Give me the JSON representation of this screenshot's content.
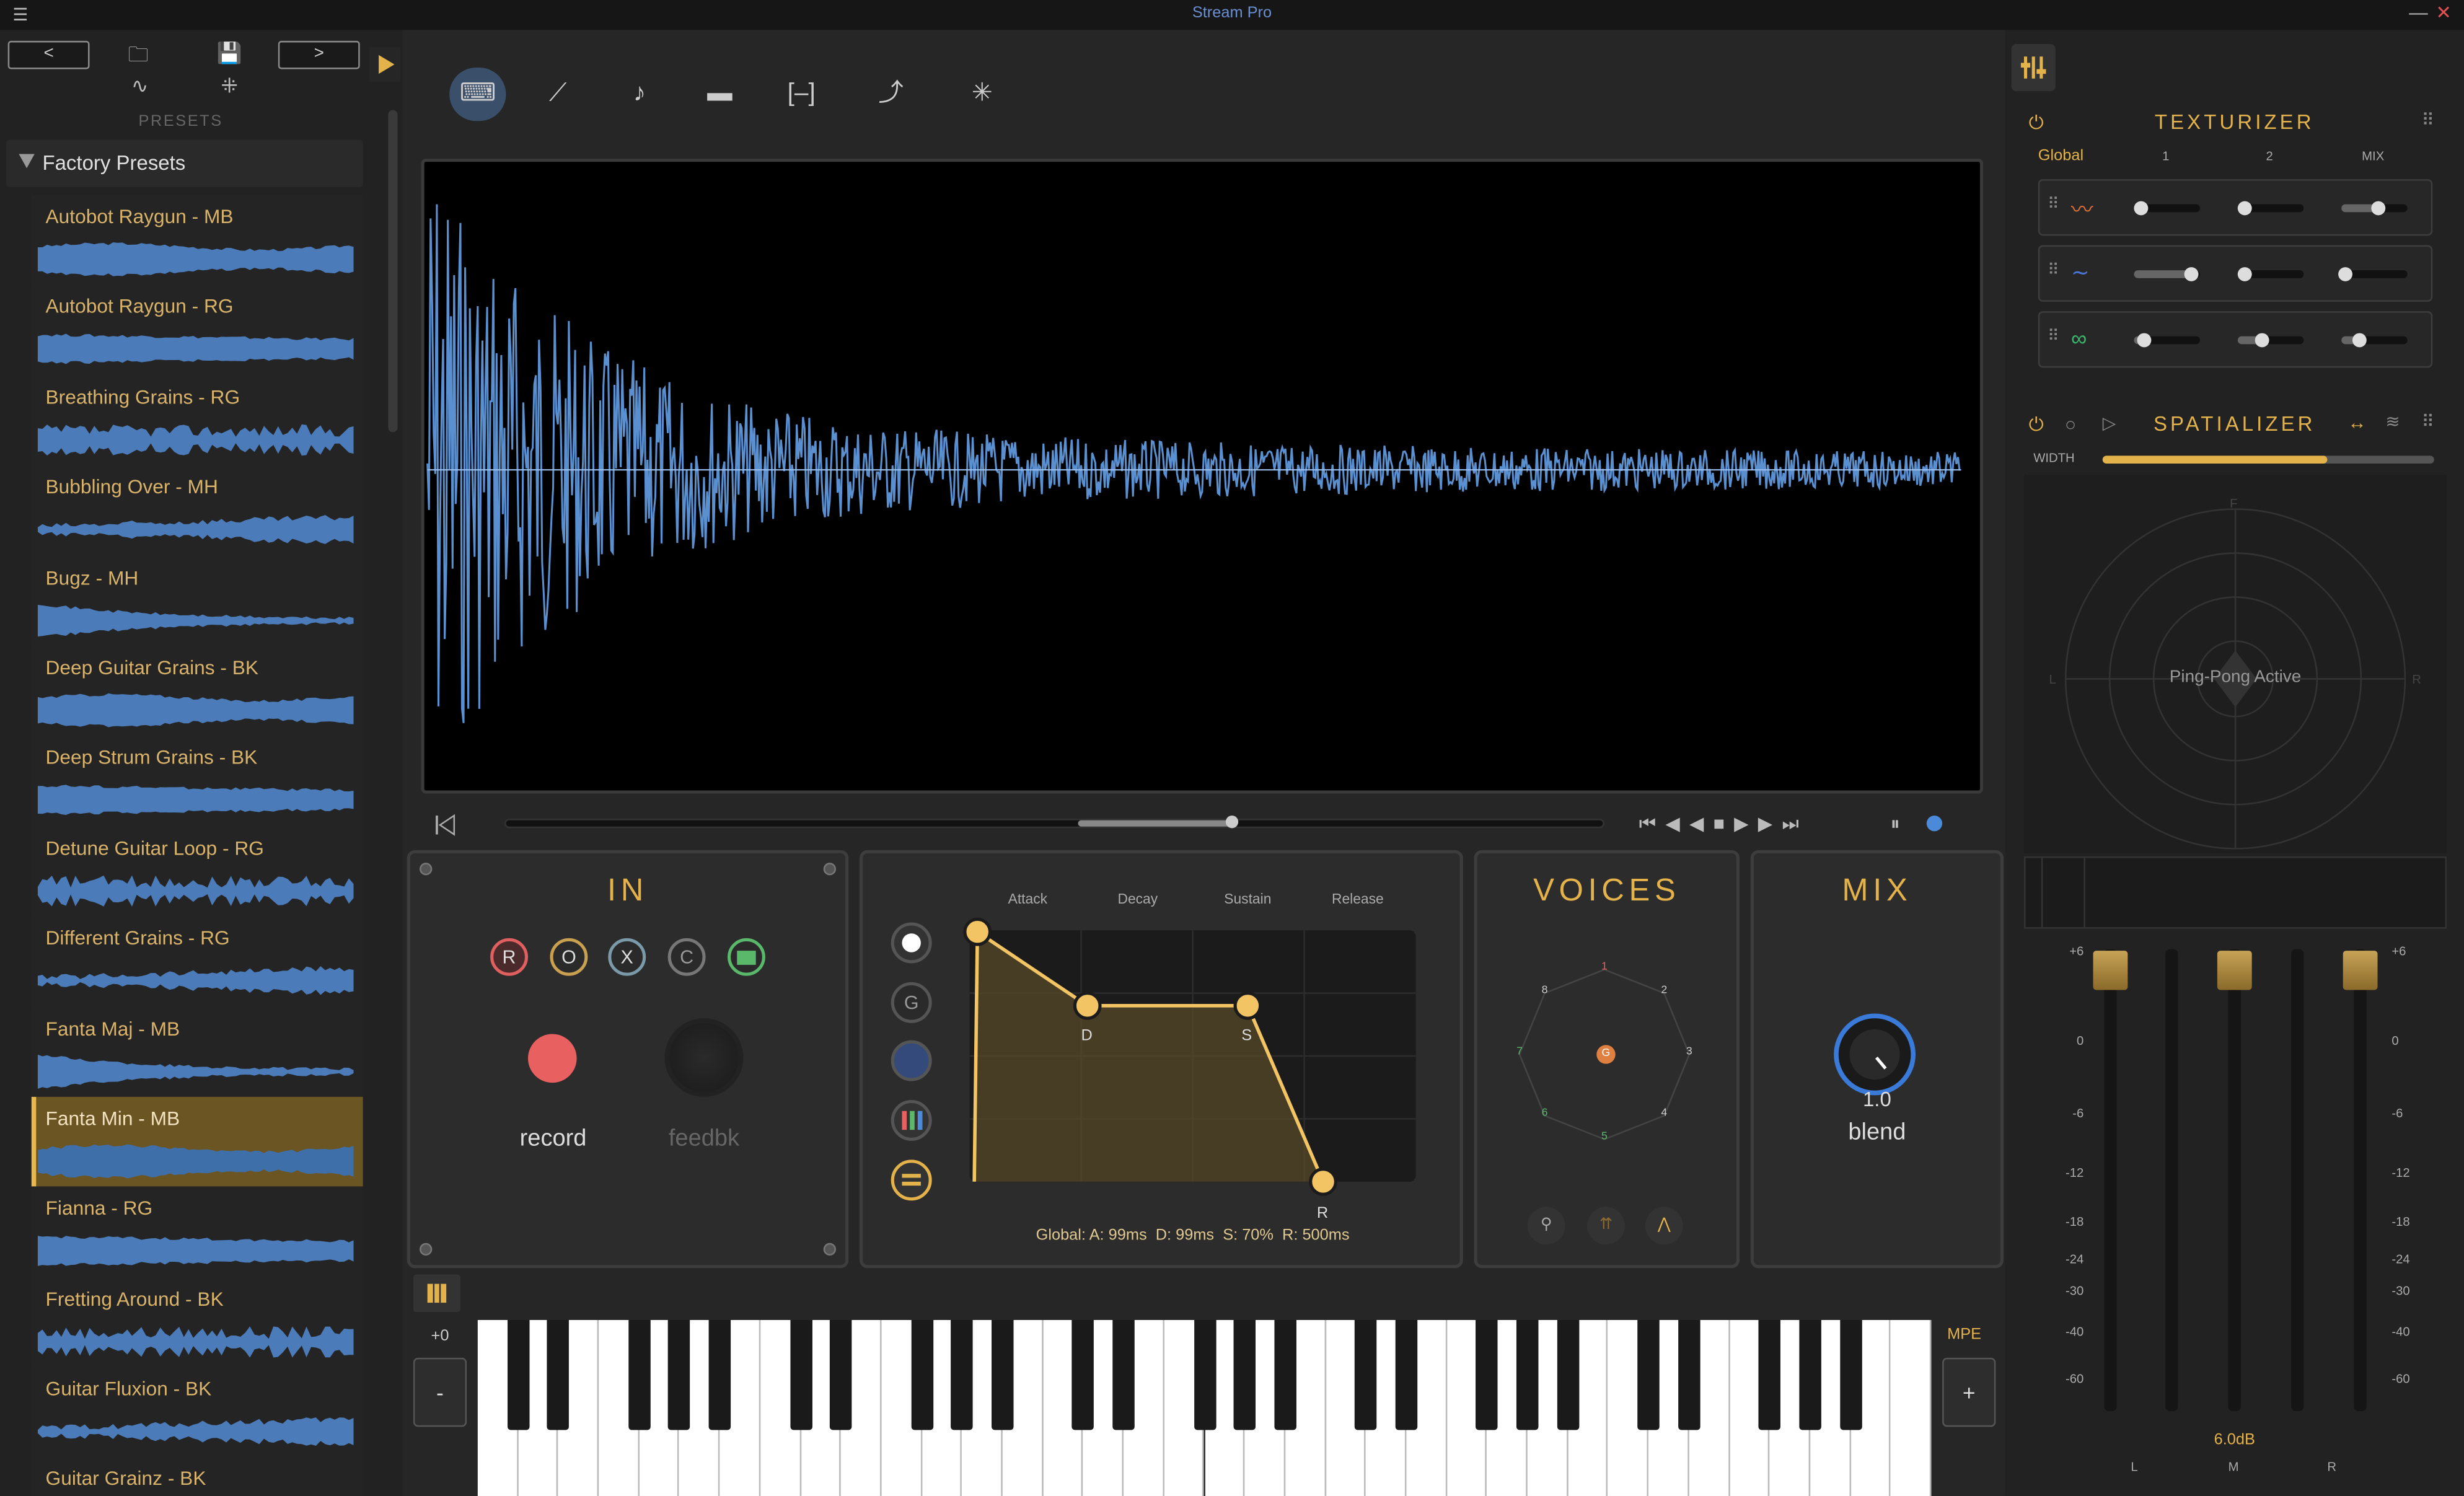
{
  "app": {
    "title": "Stream Pro"
  },
  "nav": {
    "back": "<",
    "forward": ">",
    "presets_label": "PRESETS",
    "factory_label": "Factory Presets"
  },
  "presets": [
    {
      "name": "Autobot Raygun - MB",
      "selected": false
    },
    {
      "name": "Autobot Raygun - RG",
      "selected": false
    },
    {
      "name": "Breathing Grains - RG",
      "selected": false
    },
    {
      "name": "Bubbling Over - MH",
      "selected": false
    },
    {
      "name": "Bugz - MH",
      "selected": false
    },
    {
      "name": "Deep Guitar Grains - BK",
      "selected": false
    },
    {
      "name": "Deep Strum Grains - BK",
      "selected": false
    },
    {
      "name": "Detune Guitar Loop - RG",
      "selected": false
    },
    {
      "name": "Different Grains - RG",
      "selected": false
    },
    {
      "name": "Fanta Maj - MB",
      "selected": false
    },
    {
      "name": "Fanta Min - MB",
      "selected": true
    },
    {
      "name": "Fianna - RG",
      "selected": false
    },
    {
      "name": "Fretting Around - BK",
      "selected": false
    },
    {
      "name": "Guitar Fluxion - BK",
      "selected": false
    },
    {
      "name": "Guitar Grainz - BK",
      "selected": false
    }
  ],
  "toolbar": [
    "keyboard-icon",
    "steps-icon",
    "note-icon",
    "stamp-icon",
    "bracket-icon",
    "curve-icon",
    "scatter-icon"
  ],
  "transport": {
    "position": 0.66,
    "loop_start": 0.52
  },
  "in_panel": {
    "title": "IN",
    "buttons": [
      "R",
      "O",
      "X",
      "C"
    ],
    "record_label": "record",
    "feedback_label": "feedbk"
  },
  "env_panel": {
    "headers": [
      "Attack",
      "Decay",
      "Sustain",
      "Release"
    ],
    "point_labels": [
      "D",
      "S",
      "R"
    ],
    "footer": "Global: A: 99ms  D: 99ms  S: 70%  R: 500ms",
    "side_buttons": [
      "G"
    ]
  },
  "voices_panel": {
    "title": "VOICES",
    "numbers": [
      "1",
      "2",
      "3",
      "4",
      "5",
      "6",
      "7",
      "8"
    ],
    "center": "G"
  },
  "mix_panel": {
    "title": "MIX",
    "value": "1.0",
    "label": "blend"
  },
  "texturizer": {
    "title": "TEXTURIZER",
    "columns": [
      "Global",
      "1",
      "2",
      "MIX"
    ],
    "rows": [
      {
        "icon": "noise-icon",
        "color": "#e0703a",
        "values": [
          0.1,
          0.1,
          0.55
        ]
      },
      {
        "icon": "wave-icon",
        "color": "#4a78d8",
        "values": [
          0.85,
          0.1,
          0.05
        ]
      },
      {
        "icon": "loop-icon",
        "color": "#3ab86a",
        "values": [
          0.15,
          0.35,
          0.25
        ]
      }
    ]
  },
  "spatializer": {
    "title": "SPATIALIZER",
    "width_label": "WIDTH",
    "width_value": 0.68,
    "center_text": "Ping-Pong Active",
    "front": "F",
    "left": "L",
    "right": "R"
  },
  "meters": {
    "scale_left": [
      "+6",
      "0",
      "-6",
      "-12",
      "-18",
      "-24",
      "-30",
      "-40",
      "-60"
    ],
    "scale_right": [
      "+6",
      "0",
      "-6",
      "-12",
      "-18",
      "-24",
      "-30",
      "-40",
      "-60"
    ],
    "gain": "6.0dB",
    "channels": [
      "L",
      "M",
      "R"
    ]
  },
  "keyboard": {
    "transpose": "+0",
    "minus": "-",
    "plus": "+",
    "mpe": "MPE"
  },
  "colors": {
    "accent": "#e4b24a",
    "wave": "#5a8fd0",
    "record": "#e86060"
  }
}
